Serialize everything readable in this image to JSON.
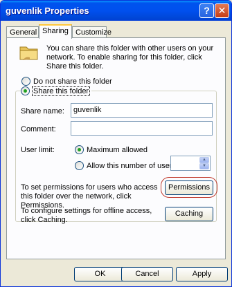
{
  "window": {
    "title": "guvenlik Properties",
    "help_glyph": "?",
    "close_glyph": "✕"
  },
  "tabs": [
    "General",
    "Sharing",
    "Customize"
  ],
  "intro_text": "You can share this folder with other users on your network. To enable sharing for this folder, click Share this folder.",
  "sharing": {
    "do_not_share_label": "Do not share this folder",
    "share_label": "Share this folder",
    "selected": "share"
  },
  "share_name": {
    "label": "Share name:",
    "value": "guvenlik"
  },
  "comment": {
    "label": "Comment:",
    "value": ""
  },
  "user_limit": {
    "label": "User limit:",
    "max_label": "Maximum allowed",
    "allow_label": "Allow this number of users:",
    "selected": "max",
    "count_value": ""
  },
  "permissions": {
    "text": "To set permissions for users who access this folder over the network, click Permissions.",
    "button": "Permissions"
  },
  "caching": {
    "text": "To configure settings for offline access, click Caching.",
    "button": "Caching"
  },
  "footer": {
    "ok": "OK",
    "cancel": "Cancel",
    "apply": "Apply"
  }
}
